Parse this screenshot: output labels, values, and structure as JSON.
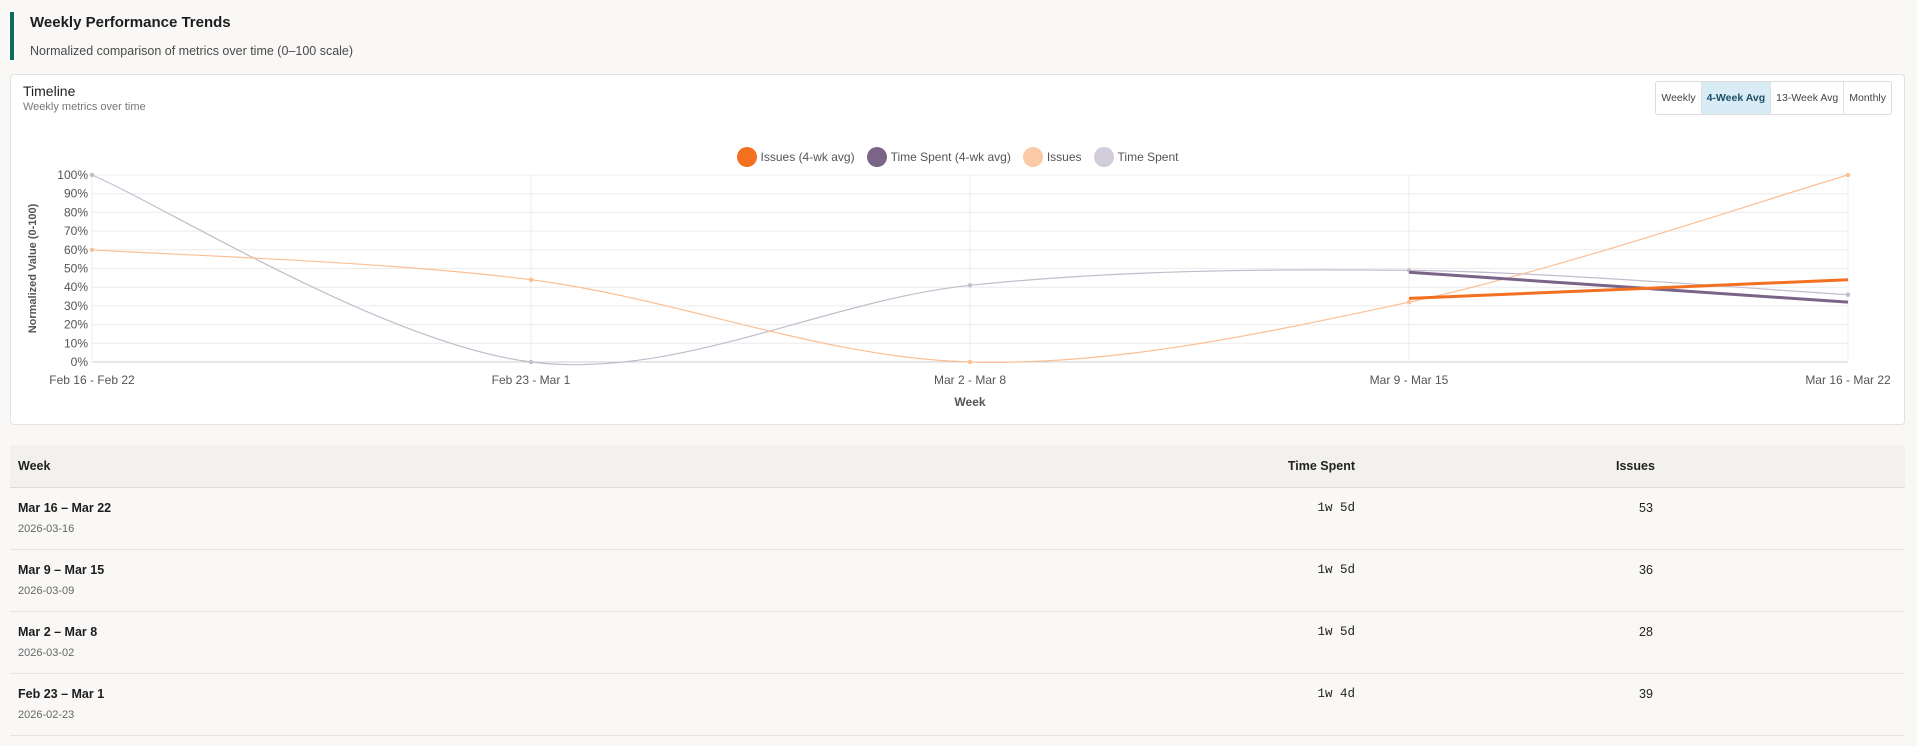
{
  "header": {
    "title": "Weekly Performance Trends",
    "subtitle": "Normalized comparison of metrics over time (0–100 scale)"
  },
  "timeline": {
    "title": "Timeline",
    "subtitle": "Weekly metrics over time",
    "views": [
      {
        "label": "Weekly",
        "active": false
      },
      {
        "label": "4-Week Avg",
        "active": true
      },
      {
        "label": "13-Week Avg",
        "active": false
      },
      {
        "label": "Monthly",
        "active": false
      }
    ]
  },
  "chart_data": {
    "type": "line",
    "xlabel": "Week",
    "ylabel": "Normalized Value (0-100)",
    "ylim": [
      0,
      100
    ],
    "yticks": [
      "0%",
      "10%",
      "20%",
      "30%",
      "40%",
      "50%",
      "60%",
      "70%",
      "80%",
      "90%",
      "100%"
    ],
    "categories": [
      "Feb 16 - Feb 22",
      "Feb 23 - Mar 1",
      "Mar 2 - Mar 8",
      "Mar 9 - Mar 15",
      "Mar 16 - Mar 22"
    ],
    "legend_position": "top-center",
    "grid": true,
    "series": [
      {
        "name": "Issues (4-wk avg)",
        "color": "#f37021",
        "values": [
          null,
          null,
          null,
          34,
          44
        ],
        "style": "thick"
      },
      {
        "name": "Time Spent (4-wk avg)",
        "color": "#7a6488",
        "values": [
          null,
          null,
          null,
          48,
          32
        ],
        "style": "thick"
      },
      {
        "name": "Issues",
        "color": "#fbbf94",
        "values": [
          60,
          44,
          0,
          32,
          100
        ],
        "style": "thin"
      },
      {
        "name": "Time Spent",
        "color": "#c4bccb",
        "values": [
          100,
          0,
          41,
          49,
          36
        ],
        "style": "thin"
      }
    ]
  },
  "table": {
    "headers": {
      "week": "Week",
      "time_spent": "Time Spent",
      "issues": "Issues"
    },
    "rows": [
      {
        "week": "Mar 16 – Mar 22",
        "date": "2026-03-16",
        "time_spent": "1w 5d",
        "issues": "53"
      },
      {
        "week": "Mar 9 – Mar 15",
        "date": "2026-03-09",
        "time_spent": "1w 5d",
        "issues": "36"
      },
      {
        "week": "Mar 2 – Mar 8",
        "date": "2026-03-02",
        "time_spent": "1w 5d",
        "issues": "28"
      },
      {
        "week": "Feb 23 – Mar 1",
        "date": "2026-02-23",
        "time_spent": "1w 4d",
        "issues": "39"
      }
    ]
  }
}
